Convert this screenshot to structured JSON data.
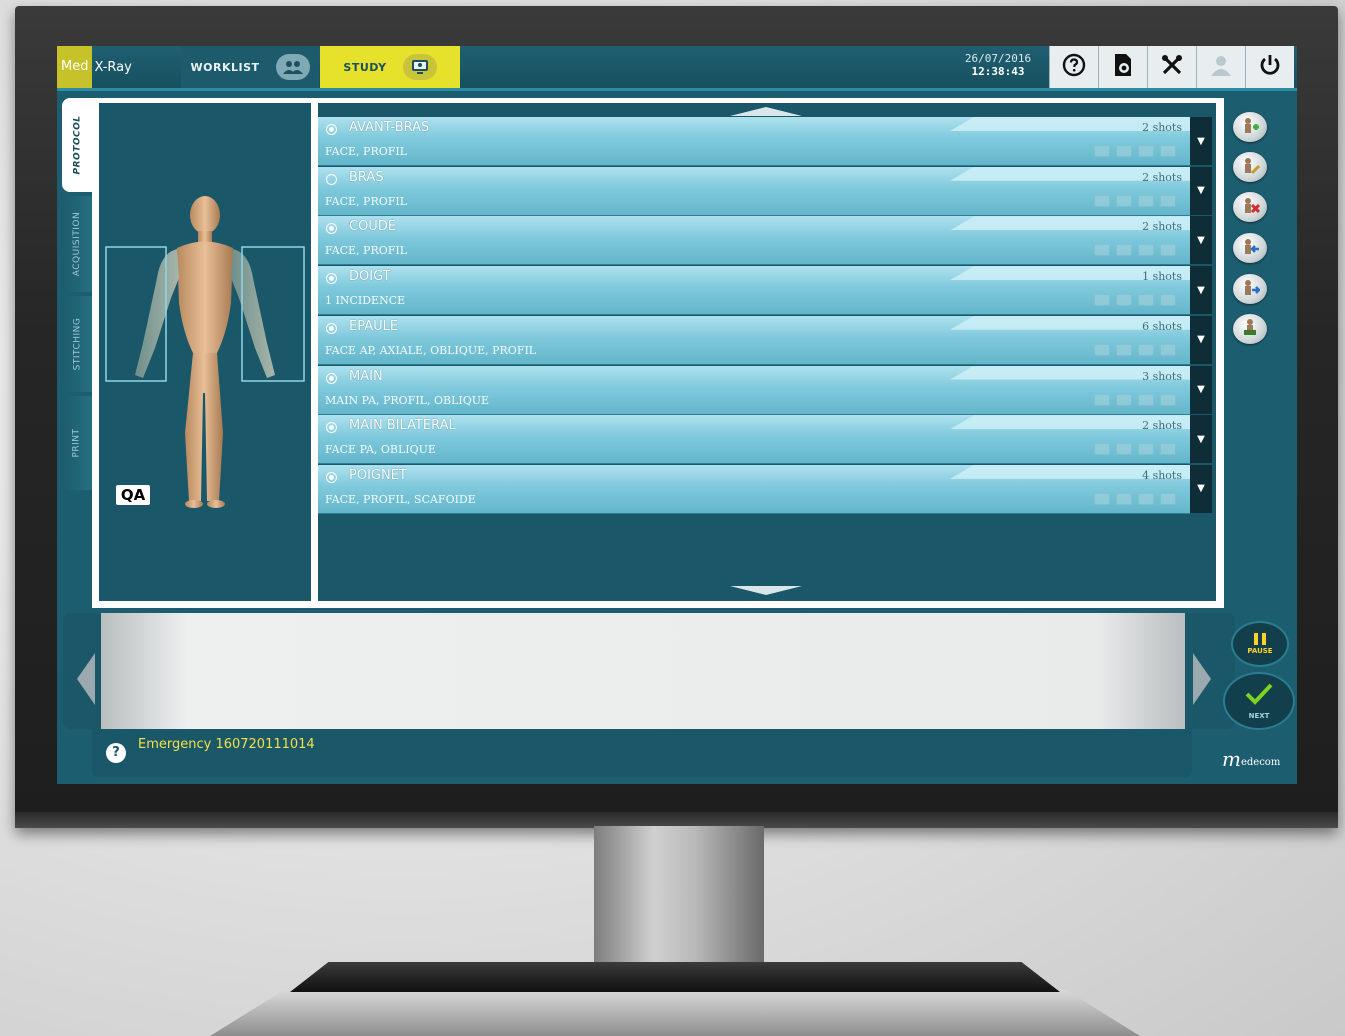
{
  "app": {
    "logo_prefix": "Med",
    "logo_suffix": "X-Ray"
  },
  "topbar": {
    "tabs": [
      {
        "label": "WORKLIST",
        "icon": "users-icon"
      },
      {
        "label": "STUDY",
        "icon": "patient-monitor-icon"
      }
    ],
    "date": "26/07/2016",
    "time": "12:38:43",
    "buttons": [
      "help-icon",
      "document-settings-icon",
      "tools-icon",
      "user-icon",
      "power-icon"
    ]
  },
  "side_tabs": [
    "PROTOCOL",
    "ACQUISITION",
    "STITCHING",
    "PRINT"
  ],
  "body_diagram": {
    "badge": "QA"
  },
  "protocols": [
    {
      "name": "AVANT-BRAS",
      "views": "FACE, PROFIL",
      "shots": "2 shots",
      "selected": true
    },
    {
      "name": "BRAS",
      "views": "FACE, PROFIL",
      "shots": "2 shots",
      "selected": false
    },
    {
      "name": "COUDE",
      "views": "FACE, PROFIL",
      "shots": "2 shots",
      "selected": true
    },
    {
      "name": "DOIGT",
      "views": "1 INCIDENCE",
      "shots": "1 shots",
      "selected": true
    },
    {
      "name": "EPAULE",
      "views": "FACE AP, AXIALE, OBLIQUE, PROFIL",
      "shots": "6 shots",
      "selected": true
    },
    {
      "name": "MAIN",
      "views": "MAIN PA, PROFIL, OBLIQUE",
      "shots": "3 shots",
      "selected": true
    },
    {
      "name": "MAIN BILATERAL",
      "views": "FACE PA, OBLIQUE",
      "shots": "2 shots",
      "selected": true
    },
    {
      "name": "POIGNET",
      "views": "FACE, PROFIL, SCAFOIDE",
      "shots": "4 shots",
      "selected": true
    }
  ],
  "right_actions": [
    "add-protocol-icon",
    "edit-protocol-icon",
    "delete-protocol-icon",
    "import-protocol-icon",
    "export-protocol-icon",
    "save-protocol-icon"
  ],
  "controls": {
    "pause_label": "PAUSE",
    "next_label": "NEXT"
  },
  "status": {
    "help": "?",
    "text": "Emergency 160720111014"
  },
  "brand": {
    "initial": "m",
    "rest": "edecom"
  },
  "colors": {
    "accent_yellow": "#e6e22c",
    "panel_teal": "#1a5768",
    "row_blue": "#7fc9dc",
    "status_text": "#f3e04a"
  }
}
